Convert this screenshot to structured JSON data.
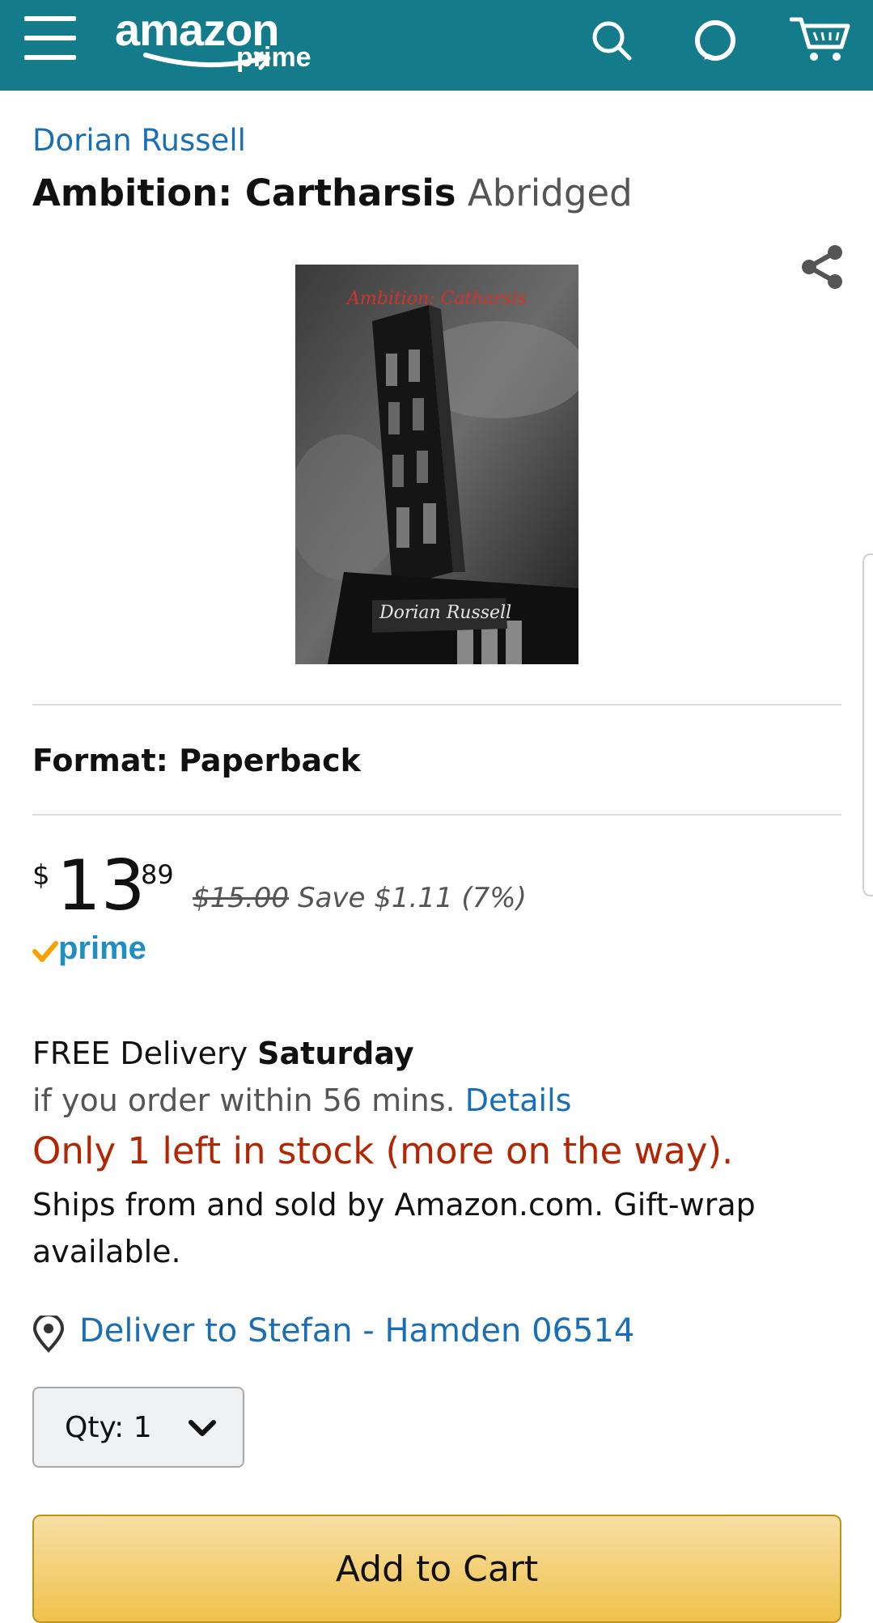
{
  "header": {
    "logo_text": "amazon",
    "logo_subtext": "prime",
    "background_color": "#147b8a"
  },
  "product": {
    "author": "Dorian Russell",
    "title": "Ambition: Cartharsis",
    "edition": "Abridged",
    "cover": {
      "title_text": "Ambition: Catharsis",
      "author_text": "Dorian Russell"
    },
    "format_label": "Format: Paperback"
  },
  "pricing": {
    "currency_symbol": "$",
    "price_whole": "13",
    "price_fraction": "89",
    "list_price": "$15.00",
    "savings": "Save $1.11 (7%)",
    "prime_label": "prime"
  },
  "delivery": {
    "free_delivery_prefix": "FREE Delivery ",
    "delivery_day": "Saturday",
    "order_within": "if you order within 56 mins.",
    "details_link": "Details",
    "stock_status": "Only 1 left in stock (more on the way).",
    "ships_from": "Ships from and sold by Amazon.com. Gift-wrap available.",
    "deliver_to": "Deliver to Stefan - Hamden 06514"
  },
  "purchase": {
    "qty_label": "Qty:",
    "qty_value": "1",
    "add_to_cart": "Add to Cart"
  },
  "colors": {
    "link": "#1a6fb4",
    "stock_warning": "#b12704",
    "cart_button": "#f0c14b",
    "prime_blue": "#1f8ec2",
    "prime_check": "#f7a200"
  },
  "icons": [
    "menu-icon",
    "search-icon",
    "alexa-icon",
    "cart-icon",
    "share-icon",
    "location-pin-icon",
    "chevron-down-icon",
    "prime-check-icon"
  ]
}
